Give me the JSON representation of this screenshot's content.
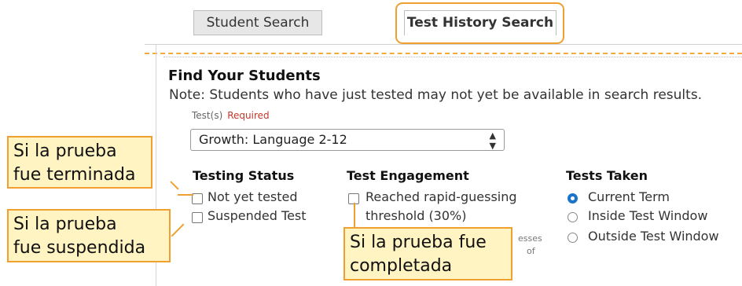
{
  "tabs": {
    "student_search": "Student Search",
    "test_history_search": "Test History Search"
  },
  "find": {
    "title": "Find Your Students",
    "note": "Note: Students who have just tested may not yet be available in search results.",
    "tests_label": "Test(s)",
    "required_label": "Required",
    "tests_value": "Growth: Language 2-12"
  },
  "testing_status": {
    "title": "Testing Status",
    "options": [
      "Not yet tested",
      "Suspended Test"
    ]
  },
  "test_engagement": {
    "title": "Test Engagement",
    "option_line1": "Reached rapid-guessing",
    "option_line2": "threshold (30%)",
    "partial_1": "esses",
    "partial_2": "of"
  },
  "tests_taken": {
    "title": "Tests Taken",
    "options": [
      "Current Term",
      "Inside Test Window",
      "Outside Test Window"
    ],
    "selected": "Current Term"
  },
  "callouts": {
    "terminated_line1": "Si la prueba",
    "terminated_line2": "fue terminada",
    "suspended_line1": "Si la prueba",
    "suspended_line2": "fue suspendida",
    "completed_line1": "Si la prueba fue",
    "completed_line2": "completada"
  },
  "colors": {
    "accent_orange": "#f0a030",
    "callout_bg": "#fff4c2",
    "radio_selected": "#1a73c9",
    "required_red": "#c0392b"
  }
}
